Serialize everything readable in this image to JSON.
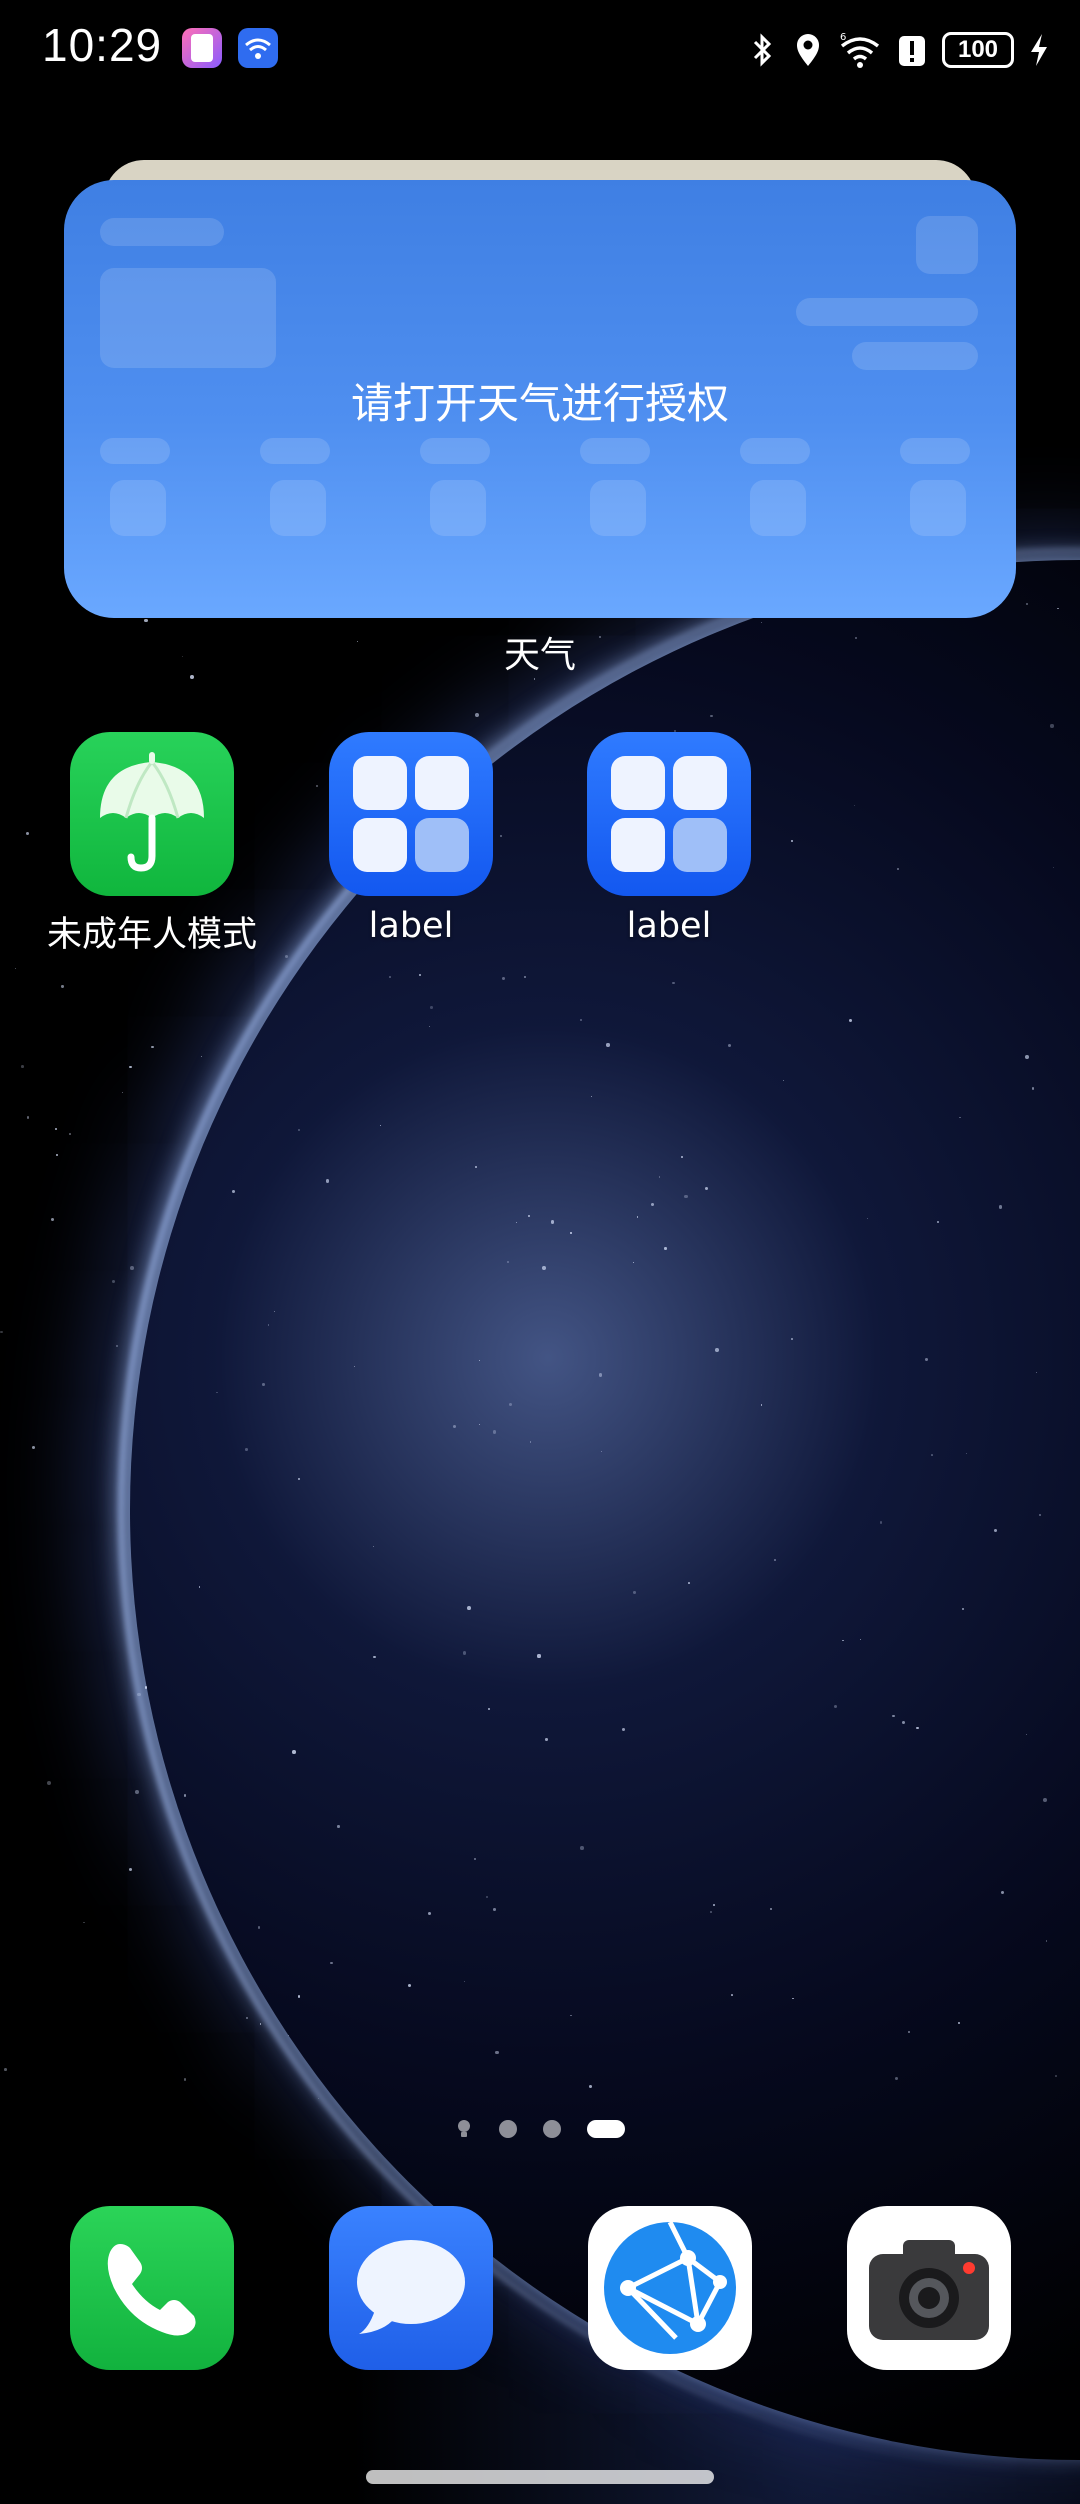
{
  "status_bar": {
    "time": "10:29",
    "battery": "100",
    "icons": [
      "app-notification-icon",
      "wifi-assistant-icon",
      "bluetooth-icon",
      "location-icon",
      "wifi-6-icon",
      "alert-icon",
      "battery-icon",
      "charging-icon"
    ]
  },
  "weather_widget": {
    "message": "请打开天气进行授权",
    "label": "天气"
  },
  "apps": [
    {
      "label": "未成年人模式",
      "icon": "umbrella-icon"
    },
    {
      "label": "label",
      "icon": "app-grid-icon"
    },
    {
      "label": "label",
      "icon": "app-grid-icon"
    }
  ],
  "pager": {
    "pages": 4,
    "active_index": 3
  },
  "dock": [
    {
      "name": "phone",
      "icon": "phone-icon",
      "color": "#1fc64a"
    },
    {
      "name": "messages",
      "icon": "message-bubble-icon",
      "color": "#2a6ef5"
    },
    {
      "name": "browser",
      "icon": "browser-network-icon",
      "color": "#ffffff"
    },
    {
      "name": "camera",
      "icon": "camera-icon",
      "color": "#ffffff"
    }
  ]
}
